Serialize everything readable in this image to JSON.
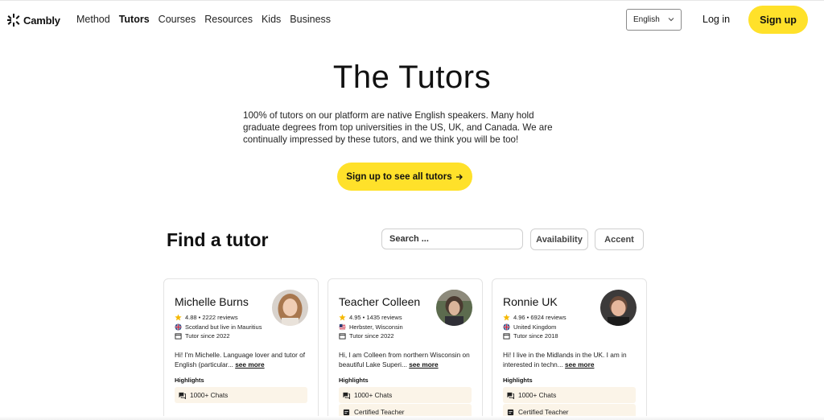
{
  "brand": {
    "name": "Cambly"
  },
  "nav": [
    "Method",
    "Tutors",
    "Courses",
    "Resources",
    "Kids",
    "Business"
  ],
  "header": {
    "language": "English",
    "login": "Log in",
    "signup": "Sign up"
  },
  "hero": {
    "title": "The Tutors",
    "text": "100% of tutors on our platform are native English speakers. Many hold graduate degrees from top universities in the US, UK, and Canada. We are continually impressed by these tutors, and we think you will be too!",
    "cta": "Sign up to see all tutors"
  },
  "find": {
    "title": "Find a tutor",
    "search_placeholder": "Search ...",
    "filter_availability": "Availability",
    "filter_accent": "Accent"
  },
  "highlights_label": "Highlights",
  "see_more": "see more",
  "tutors": [
    {
      "name": "Michelle Burns",
      "rating": "4.88 • 2222 reviews",
      "location": "Scotland but live in Mauritius",
      "since": "Tutor since 2022",
      "bio": "Hi! I'm Michelle. Language lover and tutor of English (particular...",
      "flag": "uk",
      "highlights": [
        "1000+ Chats"
      ]
    },
    {
      "name": "Teacher Colleen",
      "rating": "4.95 • 1435 reviews",
      "location": "Herbster, Wisconsin",
      "since": "Tutor since 2022",
      "bio": "Hi, I am Colleen from northern Wisconsin on beautiful Lake Superi...",
      "flag": "us",
      "highlights": [
        "1000+ Chats",
        "Certified Teacher"
      ]
    },
    {
      "name": "Ronnie UK",
      "rating": "4.96 • 6924 reviews",
      "location": "United Kingdom",
      "since": "Tutor since 2018",
      "bio": "Hi! I live in the Midlands in the UK. I am in interested in techn...",
      "flag": "uk",
      "highlights": [
        "1000+ Chats",
        "Certified Teacher"
      ]
    }
  ],
  "colors": {
    "accent": "#ffe12a",
    "highlight_bg": "#fbf4e8",
    "star": "#f5b800"
  }
}
